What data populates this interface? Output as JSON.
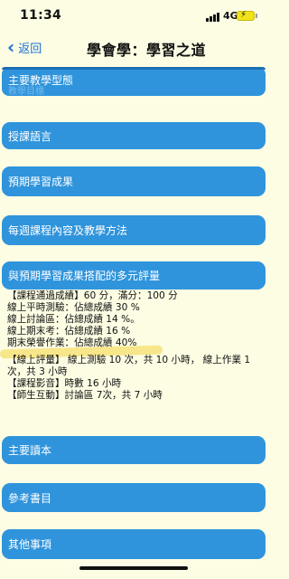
{
  "status_bar": {
    "time": "11:34",
    "network": "4G",
    "battery_color": "#f2e21a"
  },
  "nav": {
    "back_label": "返回",
    "title": "學會學：學習之道"
  },
  "sections": {
    "main_form": "主要教學型態",
    "main_form_ghost": "教學目標",
    "language": "授課語言",
    "outcomes": "預期學習成果",
    "weekly": "每週課程內容及教學方法",
    "assessment": "與預期學習成果搭配的多元評量",
    "readings": "主要讀本",
    "references": "參考書目",
    "other": "其他事項"
  },
  "assessment_content": {
    "line1": "【課程通過成績】60 分，滿分：100 分",
    "line2": "線上平時測驗：佔總成績 30 %",
    "line3": "線上討論區：佔總成績 14 %。",
    "line4": "線上期末考：佔總成績 16 %",
    "line5": "期末榮譽作業：佔總成績 40%",
    "line6": "【線上評量】 線上測驗 10 次，共 10 小時， 線上作業 1 次，共 3 小時",
    "line7": "【課程影音】時數 16 小時",
    "line8": "【師生互動】討論區 7次，共 7 小時"
  },
  "colors": {
    "section_bg": "#2f94dc",
    "page_bg": "#fdfde4",
    "link": "#1a6fd8",
    "highlight": "#f7e27a"
  }
}
